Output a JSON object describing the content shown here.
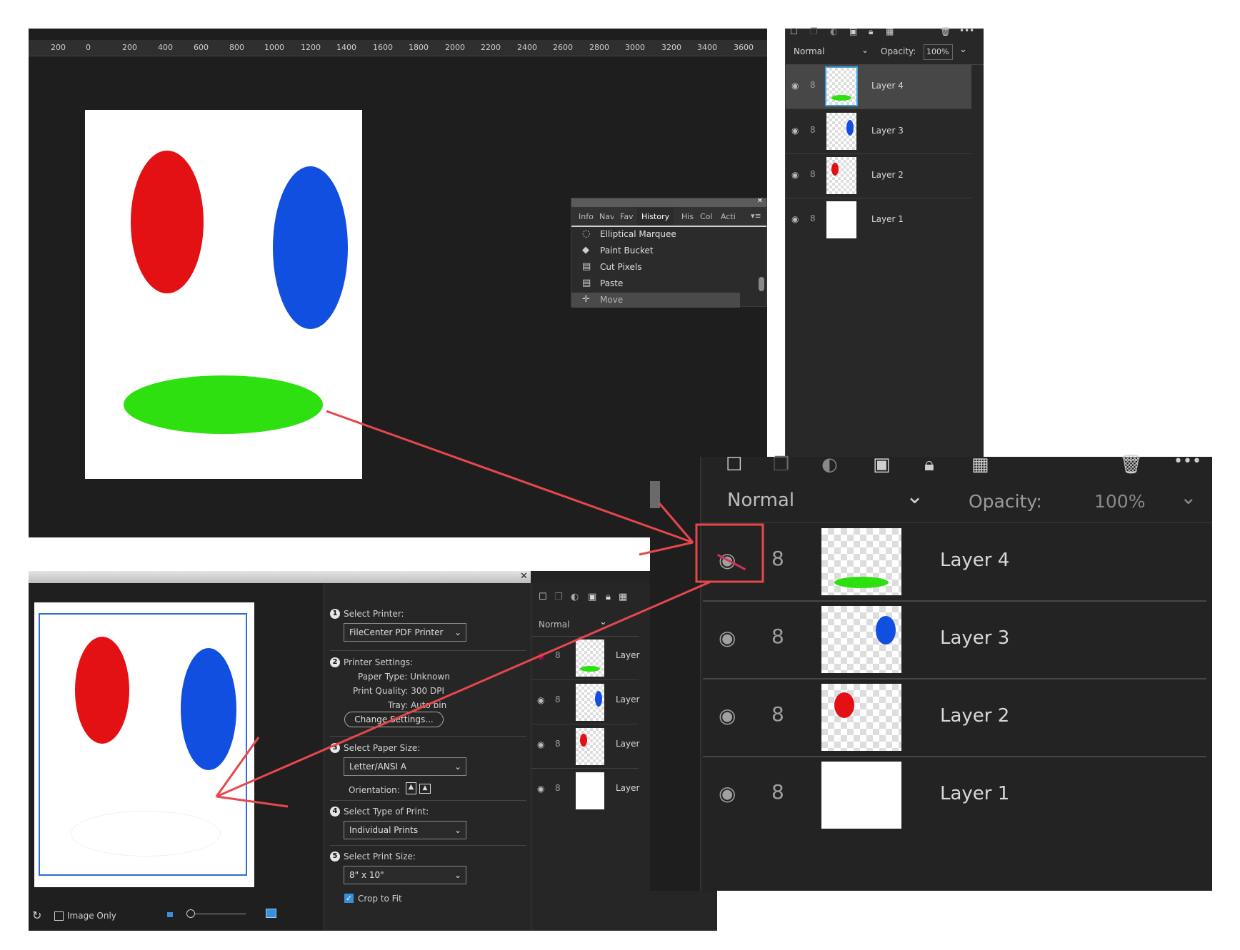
{
  "ruler": [
    "200",
    "0",
    "200",
    "400",
    "600",
    "800",
    "1000",
    "1200",
    "1400",
    "1600",
    "1800",
    "2000",
    "2200",
    "2400",
    "2600",
    "2800",
    "3000",
    "3200",
    "3400",
    "3600"
  ],
  "layers_top": {
    "blend_mode": "Normal",
    "opacity_label": "Opacity:",
    "opacity_value": "100%",
    "layers": [
      "Layer 4",
      "Layer 3",
      "Layer 2",
      "Layer 1"
    ]
  },
  "history_panel": {
    "tabs": [
      "Info",
      "Nav",
      "Fav",
      "History",
      "His",
      "Col",
      "Acti"
    ],
    "items": [
      "Elliptical Marquee",
      "Paint Bucket",
      "Cut Pixels",
      "Paste",
      "Move"
    ]
  },
  "print_dialog": {
    "close_glyph": "✕",
    "select_printer_label": "Select Printer:",
    "printer_value": "FileCenter PDF Printer",
    "printer_settings_label": "Printer Settings:",
    "paper_type": "Paper Type: Unknown",
    "print_quality": "Print Quality: 300 DPI",
    "tray": "Tray: Auto bin",
    "change_settings": "Change Settings...",
    "select_paper_size_label": "Select Paper Size:",
    "paper_size_value": "Letter/ANSI A",
    "orientation_label": "Orientation:",
    "select_type_label": "Select Type of Print:",
    "type_value": "Individual Prints",
    "select_print_size_label": "Select Print Size:",
    "print_size_value": "8\" x 10\"",
    "crop_to_fit": "Crop to Fit",
    "image_only": "Image Only",
    "steps": [
      "1",
      "2",
      "3",
      "4",
      "5"
    ]
  },
  "layers_mini": {
    "blend_mode": "Normal",
    "layers": [
      "Layer",
      "Layer",
      "Layer",
      "Layer"
    ]
  },
  "layers_zoom": {
    "blend_mode": "Normal",
    "opacity_label": "Opacity:",
    "opacity_value": "100%",
    "layers": [
      "Layer 4",
      "Layer 3",
      "Layer 2",
      "Layer 1"
    ]
  },
  "colors": {
    "red": "#e31014",
    "blue": "#114fe0",
    "green": "#2ee010",
    "callout": "#e8474b"
  }
}
